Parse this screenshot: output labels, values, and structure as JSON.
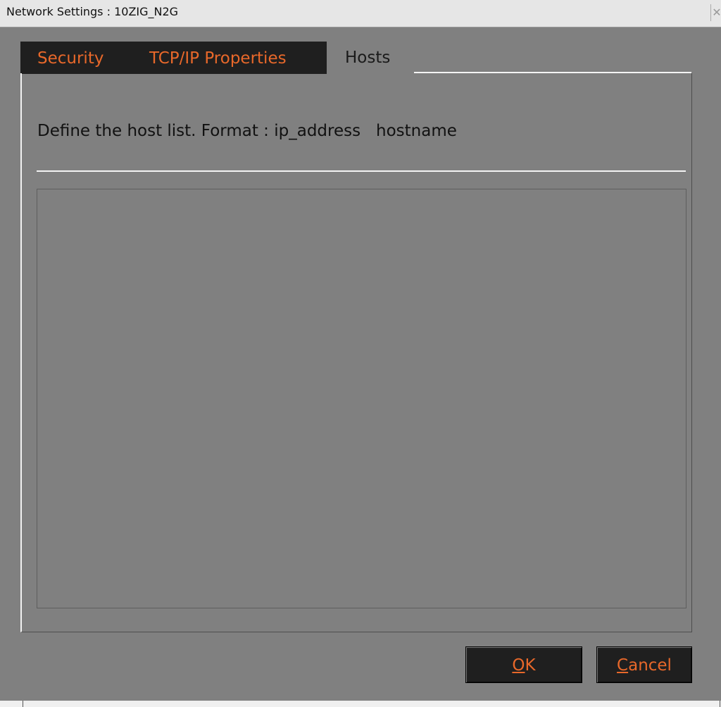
{
  "window": {
    "title": "Network Settings : 10ZIG_N2G",
    "close_glyph": "✕"
  },
  "tabs": [
    {
      "label": "Security",
      "active": false
    },
    {
      "label": "TCP/IP Properties",
      "active": false
    },
    {
      "label": "Hosts",
      "active": true
    }
  ],
  "hosts_panel": {
    "description": "Define the host list. Format : ip_address   hostname",
    "host_list_value": ""
  },
  "buttons": {
    "ok": {
      "mnemonic": "O",
      "rest": "K"
    },
    "cancel": {
      "mnemonic": "C",
      "rest": "ancel"
    }
  },
  "colors": {
    "background": "#808080",
    "tab_inactive_bg": "#1f1f1f",
    "accent_text": "#e8682a"
  },
  "icons": {
    "close": "close-icon"
  }
}
